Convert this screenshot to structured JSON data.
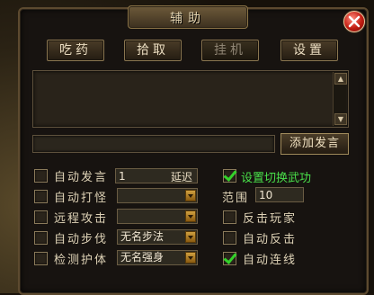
{
  "window": {
    "title": "辅助"
  },
  "tabs": [
    {
      "label": "吃药",
      "active": false
    },
    {
      "label": "拾取",
      "active": false
    },
    {
      "label": "挂机",
      "active": true
    },
    {
      "label": "设置",
      "active": false
    }
  ],
  "chat": {
    "log_text": "",
    "input_value": "",
    "send_label": "添加发言",
    "scroll_up_icon": "arrow-up-icon",
    "scroll_down_icon": "arrow-down-icon"
  },
  "left_options": [
    {
      "label": "自动发言",
      "checked": false,
      "value": "1",
      "suffix": "延迟"
    },
    {
      "label": "自动打怪",
      "checked": false,
      "select": ""
    },
    {
      "label": "远程攻击",
      "checked": false,
      "select": ""
    },
    {
      "label": "自动步伐",
      "checked": false,
      "select": "无名步法"
    },
    {
      "label": "检测护体",
      "checked": false,
      "select": "无名强身"
    }
  ],
  "right_options": {
    "weapon_switch": {
      "label": "设置切换武功",
      "checked": true
    },
    "range": {
      "label": "范围",
      "value": "10"
    },
    "counter_player": {
      "label": "反击玩家",
      "checked": false
    },
    "auto_counter": {
      "label": "自动反击",
      "checked": false
    },
    "auto_chain": {
      "label": "自动连线",
      "checked": true
    }
  },
  "colors": {
    "accent_green": "#49e04a",
    "frame_gold": "#8a7650",
    "close_red": "#c21d12"
  }
}
